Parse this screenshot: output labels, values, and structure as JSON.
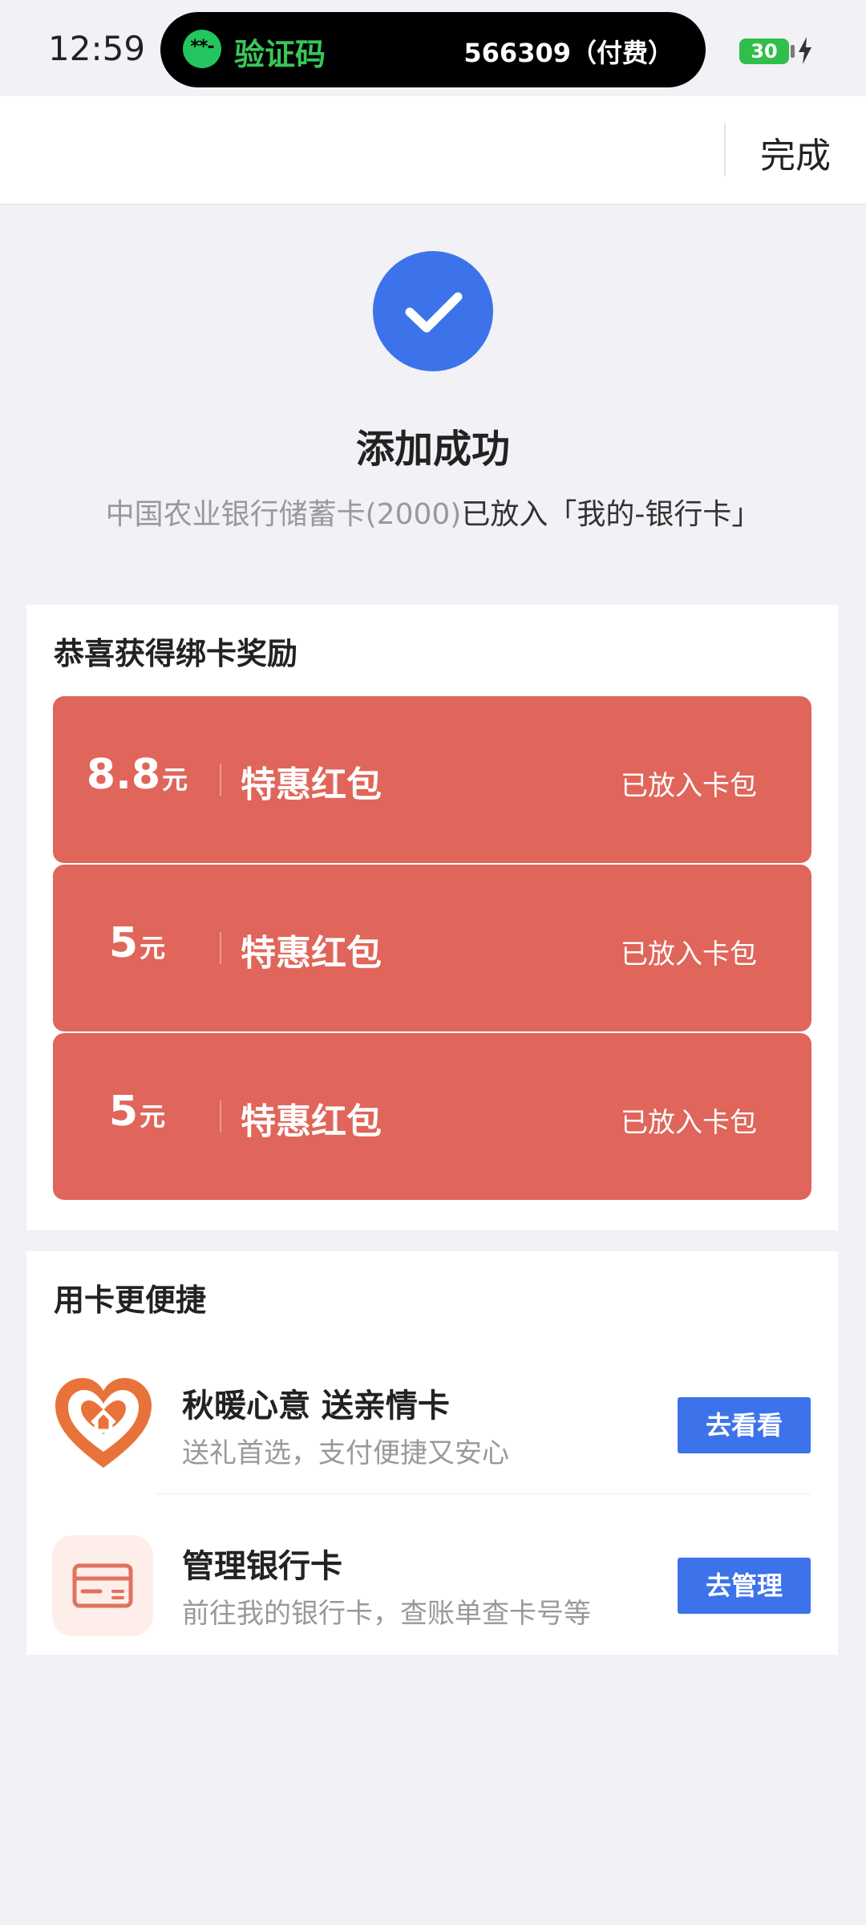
{
  "status_bar": {
    "time": "12:59",
    "notification": {
      "app_icon_glyph": "**-",
      "title": "验证码",
      "code": "566309（付费）"
    },
    "battery": "30"
  },
  "nav": {
    "done_label": "完成"
  },
  "success": {
    "title": "添加成功",
    "desc_muted": "中国农业银行储蓄卡(2000)",
    "desc_main": "已放入「我的-银行卡」"
  },
  "rewards": {
    "title": "恭喜获得绑卡奖励",
    "items": [
      {
        "amount": "8.8",
        "unit": "元",
        "name": "特惠红包",
        "status": "已放入卡包"
      },
      {
        "amount": "5",
        "unit": "元",
        "name": "特惠红包",
        "status": "已放入卡包"
      },
      {
        "amount": "5",
        "unit": "元",
        "name": "特惠红包",
        "status": "已放入卡包"
      }
    ]
  },
  "convenience": {
    "title": "用卡更便捷",
    "items": [
      {
        "title": "秋暖心意 送亲情卡",
        "subtitle": "送礼首选，支付便捷又安心",
        "button": "去看看",
        "icon": "heart-home-icon"
      },
      {
        "title": "管理银行卡",
        "subtitle": "前往我的银行卡，查账单查卡号等",
        "button": "去管理",
        "icon": "bank-card-icon"
      }
    ]
  },
  "colors": {
    "accent_blue": "#3d73ea",
    "coupon_red": "#e0655a",
    "notif_green": "#38c75a",
    "heart_orange": "#e8733a"
  }
}
